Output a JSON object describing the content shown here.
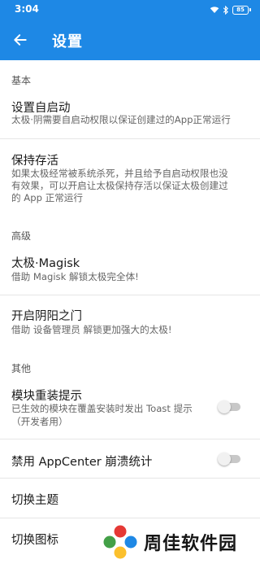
{
  "status_bar": {
    "time": "3:04",
    "battery": "85",
    "icons": [
      "wifi-icon",
      "bluetooth-icon",
      "battery-icon"
    ]
  },
  "app_bar": {
    "title": "设置",
    "back_icon": "arrow-left-icon",
    "color": "#1e88e5"
  },
  "sections": {
    "basic": "基本",
    "advanced": "高级",
    "other": "其他"
  },
  "items": {
    "autostart": {
      "title": "设置自启动",
      "subtitle": "太极·阴需要自启动权限以保证创建过的App正常运行"
    },
    "keepalive": {
      "title": "保持存活",
      "subtitle_lines": [
        "如果太极经常被系统杀死，并且给予自启动权限也没",
        "有效果，可以开启让太极保持存活以保证太极创建过",
        "的 App 正常运行"
      ]
    },
    "magisk": {
      "title": "太极·Magisk",
      "subtitle": "借助 Magisk 解锁太极完全体!"
    },
    "yinyang": {
      "title": "开启阴阳之门",
      "subtitle": "借助 设备管理员 解锁更加强大的太极!"
    },
    "reinstall_hint": {
      "title": "模块重装提示",
      "subtitle_lines": [
        "已生效的模块在覆盖安装时发出 Toast 提示",
        "（开发者用）"
      ],
      "enabled": false
    },
    "appcenter": {
      "title": "禁用 AppCenter 崩溃统计",
      "enabled": false
    },
    "theme": {
      "title": "切换主题"
    },
    "icon": {
      "title": "切换图标"
    }
  },
  "watermark": {
    "text": "周佳软件园",
    "logo_icon": "pinwheel-logo-icon"
  }
}
